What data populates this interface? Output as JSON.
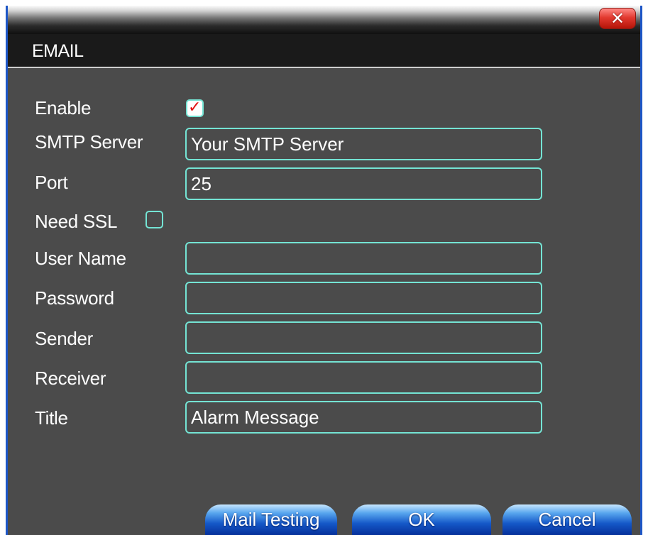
{
  "dialog": {
    "title": "EMAIL",
    "close_glyph": "✕"
  },
  "form": {
    "enable": {
      "label": "Enable",
      "checked": true,
      "check_glyph": "✓"
    },
    "smtp_server": {
      "label": "SMTP Server",
      "value": "Your SMTP Server"
    },
    "port": {
      "label": "Port",
      "value": "25"
    },
    "need_ssl": {
      "label": "Need SSL",
      "checked": false
    },
    "user_name": {
      "label": "User Name",
      "value": ""
    },
    "password": {
      "label": "Password",
      "value": ""
    },
    "sender": {
      "label": "Sender",
      "value": ""
    },
    "receiver": {
      "label": "Receiver",
      "value": ""
    },
    "title": {
      "label": "Title",
      "value": "Alarm Message"
    }
  },
  "buttons": {
    "mail_testing": "Mail Testing",
    "ok": "OK",
    "cancel": "Cancel"
  },
  "colors": {
    "window_bg": "#4b4b4b",
    "header_bg": "#1a1a1a",
    "field_border": "#74e4d4",
    "close_red": "#e23a30",
    "button_blue": "#1558c8",
    "frame_blue": "#1e56c6"
  },
  "icons": {
    "close": "close-icon",
    "check": "checkmark-icon"
  }
}
